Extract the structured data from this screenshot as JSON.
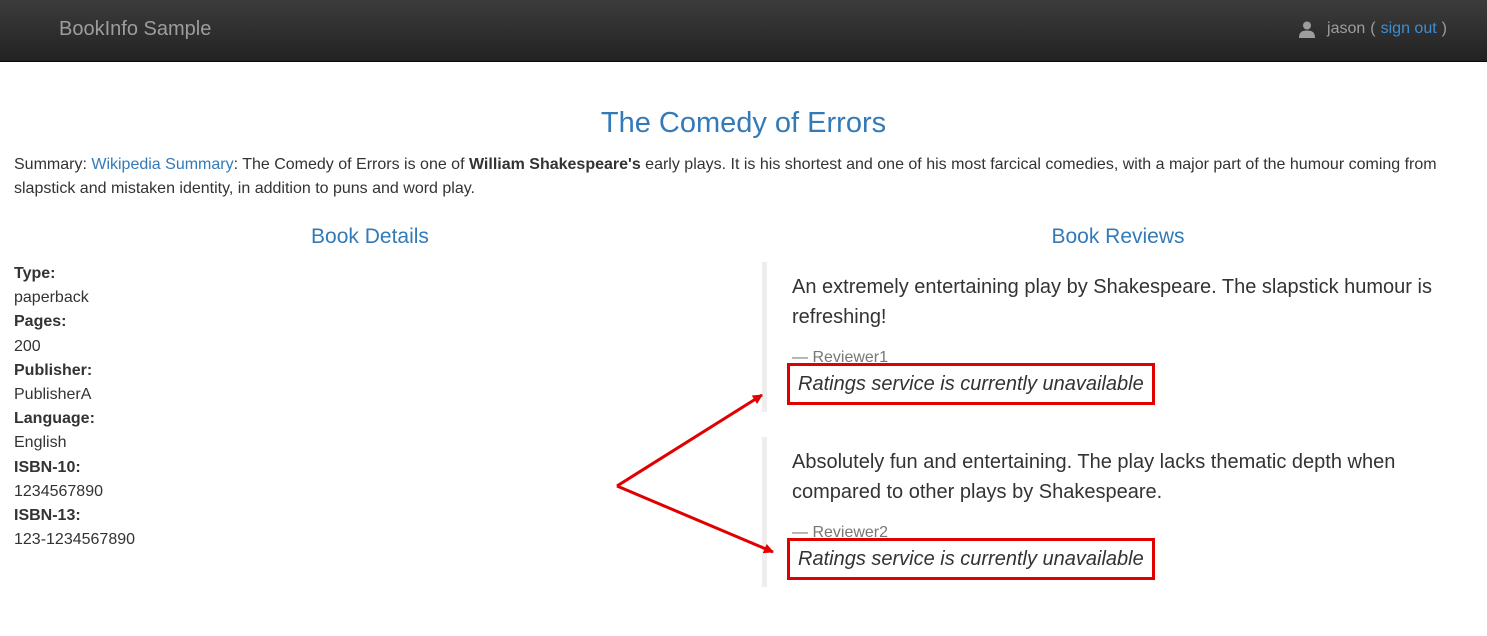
{
  "navbar": {
    "brand": "BookInfo Sample",
    "username": "jason",
    "open_paren": "(",
    "sign_out": "sign out",
    "close_paren": ")",
    "user_icon": "user-icon"
  },
  "book": {
    "title": "The Comedy of Errors",
    "summary_label": "Summary: ",
    "summary_link": "Wikipedia Summary",
    "summary_part1": ": The Comedy of Errors is one of ",
    "summary_bold": "William Shakespeare's",
    "summary_part2": " early plays. It is his shortest and one of his most farcical comedies, with a major part of the humour coming from slapstick and mistaken identity, in addition to puns and word play."
  },
  "details": {
    "heading": "Book Details",
    "fields": [
      {
        "label": "Type:",
        "value": "paperback"
      },
      {
        "label": "Pages:",
        "value": "200"
      },
      {
        "label": "Publisher:",
        "value": "PublisherA"
      },
      {
        "label": "Language:",
        "value": "English"
      },
      {
        "label": "ISBN-10:",
        "value": "1234567890"
      },
      {
        "label": "ISBN-13:",
        "value": "123-1234567890"
      }
    ]
  },
  "reviews": {
    "heading": "Book Reviews",
    "items": [
      {
        "text": "An extremely entertaining play by Shakespeare. The slapstick humour is refreshing!",
        "reviewer": "— Reviewer1",
        "rating_message": "Ratings service is currently unavailable"
      },
      {
        "text": "Absolutely fun and entertaining. The play lacks thematic depth when compared to other plays by Shakespeare.",
        "reviewer": "— Reviewer2",
        "rating_message": "Ratings service is currently unavailable"
      }
    ]
  },
  "colors": {
    "annotation": "#e00000",
    "link": "#337ab7",
    "navbar": "#222222"
  }
}
